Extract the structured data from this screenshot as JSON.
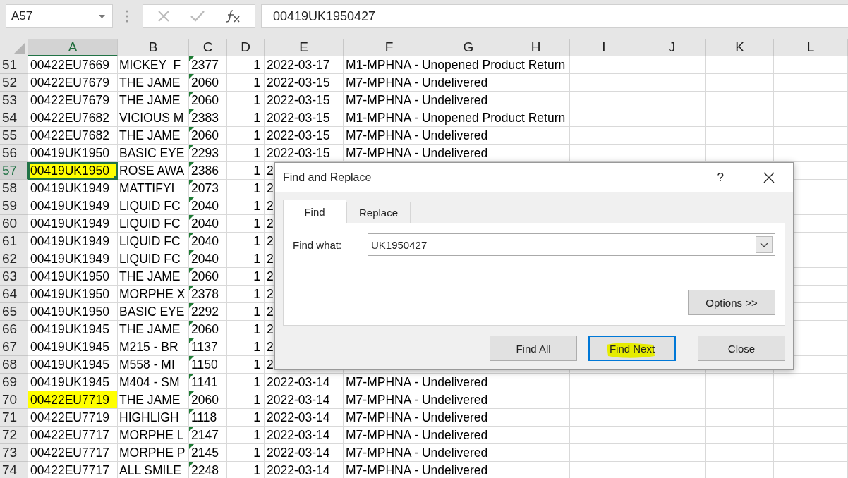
{
  "name_box": {
    "value": "A57"
  },
  "formula_bar": {
    "value": "00419UK1950427"
  },
  "columns": [
    {
      "label": "A",
      "selected": true
    },
    {
      "label": "B",
      "selected": false
    },
    {
      "label": "C",
      "selected": false
    },
    {
      "label": "D",
      "selected": false
    },
    {
      "label": "E",
      "selected": false
    },
    {
      "label": "F",
      "selected": false
    },
    {
      "label": "G",
      "selected": false
    },
    {
      "label": "H",
      "selected": false
    },
    {
      "label": "I",
      "selected": false
    },
    {
      "label": "J",
      "selected": false
    },
    {
      "label": "K",
      "selected": false
    },
    {
      "label": "L",
      "selected": false
    }
  ],
  "rows": [
    {
      "number": "51",
      "selected": false,
      "highlighted": false,
      "cells": [
        "00422EU7669",
        "MICKEY  F",
        "2377",
        "1",
        "2022-03-17",
        "M1-MPHNA - Unopened Product Return"
      ]
    },
    {
      "number": "52",
      "selected": false,
      "highlighted": false,
      "cells": [
        "00422EU7679",
        "THE JAME",
        "2060",
        "1",
        "2022-03-15",
        "M7-MPHNA - Undelivered"
      ]
    },
    {
      "number": "53",
      "selected": false,
      "highlighted": false,
      "cells": [
        "00422EU7679",
        "THE JAME",
        "2060",
        "1",
        "2022-03-15",
        "M7-MPHNA - Undelivered"
      ]
    },
    {
      "number": "54",
      "selected": false,
      "highlighted": false,
      "cells": [
        "00422EU7682",
        "VICIOUS M",
        "2383",
        "1",
        "2022-03-15",
        "M1-MPHNA - Unopened Product Return"
      ]
    },
    {
      "number": "55",
      "selected": false,
      "highlighted": false,
      "cells": [
        "00422EU7682",
        "THE JAME",
        "2060",
        "1",
        "2022-03-15",
        "M7-MPHNA - Undelivered"
      ]
    },
    {
      "number": "56",
      "selected": false,
      "highlighted": false,
      "cells": [
        "00419UK1950",
        "BASIC EYE",
        "2293",
        "1",
        "2022-03-15",
        "M7-MPHNA - Undelivered"
      ]
    },
    {
      "number": "57",
      "selected": true,
      "highlighted": true,
      "cells": [
        "00419UK1950",
        "ROSE AWA",
        "2386",
        "1",
        "2"
      ]
    },
    {
      "number": "58",
      "selected": false,
      "highlighted": false,
      "cells": [
        "00419UK1949",
        "MATTIFYI",
        "2073",
        "1",
        "2"
      ]
    },
    {
      "number": "59",
      "selected": false,
      "highlighted": false,
      "cells": [
        "00419UK1949",
        "LIQUID FC",
        "2040",
        "1",
        "2"
      ]
    },
    {
      "number": "60",
      "selected": false,
      "highlighted": false,
      "cells": [
        "00419UK1949",
        "LIQUID FC",
        "2040",
        "1",
        "2"
      ]
    },
    {
      "number": "61",
      "selected": false,
      "highlighted": false,
      "cells": [
        "00419UK1949",
        "LIQUID FC",
        "2040",
        "1",
        "2"
      ]
    },
    {
      "number": "62",
      "selected": false,
      "highlighted": false,
      "cells": [
        "00419UK1949",
        "LIQUID FC",
        "2040",
        "1",
        "2"
      ]
    },
    {
      "number": "63",
      "selected": false,
      "highlighted": false,
      "cells": [
        "00419UK1950",
        "THE JAME",
        "2060",
        "1",
        "2"
      ]
    },
    {
      "number": "64",
      "selected": false,
      "highlighted": false,
      "cells": [
        "00419UK1950",
        "MORPHE X",
        "2378",
        "1",
        "2"
      ]
    },
    {
      "number": "65",
      "selected": false,
      "highlighted": false,
      "cells": [
        "00419UK1950",
        "BASIC EYE",
        "2292",
        "1",
        "2"
      ]
    },
    {
      "number": "66",
      "selected": false,
      "highlighted": false,
      "cells": [
        "00419UK1945",
        "THE JAME",
        "2060",
        "1",
        "2"
      ]
    },
    {
      "number": "67",
      "selected": false,
      "highlighted": false,
      "cells": [
        "00419UK1945",
        "M215 - BR",
        "1137",
        "1",
        "2"
      ]
    },
    {
      "number": "68",
      "selected": false,
      "highlighted": false,
      "cells": [
        "00419UK1945",
        "M558 - MI",
        "1150",
        "1",
        "2"
      ]
    },
    {
      "number": "69",
      "selected": false,
      "highlighted": false,
      "cells": [
        "00419UK1945",
        "M404 - SM",
        "1141",
        "1",
        "2022-03-14",
        "M7-MPHNA - Undelivered"
      ]
    },
    {
      "number": "70",
      "selected": false,
      "highlighted": true,
      "cells": [
        "00422EU7719",
        "THE JAME",
        "2060",
        "1",
        "2022-03-14",
        "M7-MPHNA - Undelivered"
      ]
    },
    {
      "number": "71",
      "selected": false,
      "highlighted": false,
      "cells": [
        "00422EU7719",
        "HIGHLIGH",
        "1118",
        "1",
        "2022-03-14",
        "M7-MPHNA - Undelivered"
      ]
    },
    {
      "number": "72",
      "selected": false,
      "highlighted": false,
      "cells": [
        "00422EU7717",
        "MORPHE L",
        "2147",
        "1",
        "2022-03-14",
        "M7-MPHNA - Undelivered"
      ]
    },
    {
      "number": "73",
      "selected": false,
      "highlighted": false,
      "cells": [
        "00422EU7717",
        "MORPHE P",
        "2145",
        "1",
        "2022-03-14",
        "M7-MPHNA - Undelivered"
      ]
    },
    {
      "number": "74",
      "selected": false,
      "highlighted": false,
      "cells": [
        "00422EU7717",
        "ALL SMILE",
        "2248",
        "1",
        "2022-03-14",
        "M7-MPHNA - Undelivered"
      ]
    }
  ],
  "dialog": {
    "title": "Find and Replace",
    "help": "?",
    "tabs": [
      {
        "label": "Find",
        "selected": true
      },
      {
        "label": "Replace",
        "selected": false
      }
    ],
    "find_what": {
      "label": "Find what:",
      "value": "UK1950427"
    },
    "options_button": "Options >>",
    "buttons": [
      {
        "label": "Find All",
        "default": false,
        "marked": false
      },
      {
        "label": "Find Next",
        "default": true,
        "marked": true
      },
      {
        "label": "Close",
        "default": false,
        "marked": false
      }
    ]
  }
}
